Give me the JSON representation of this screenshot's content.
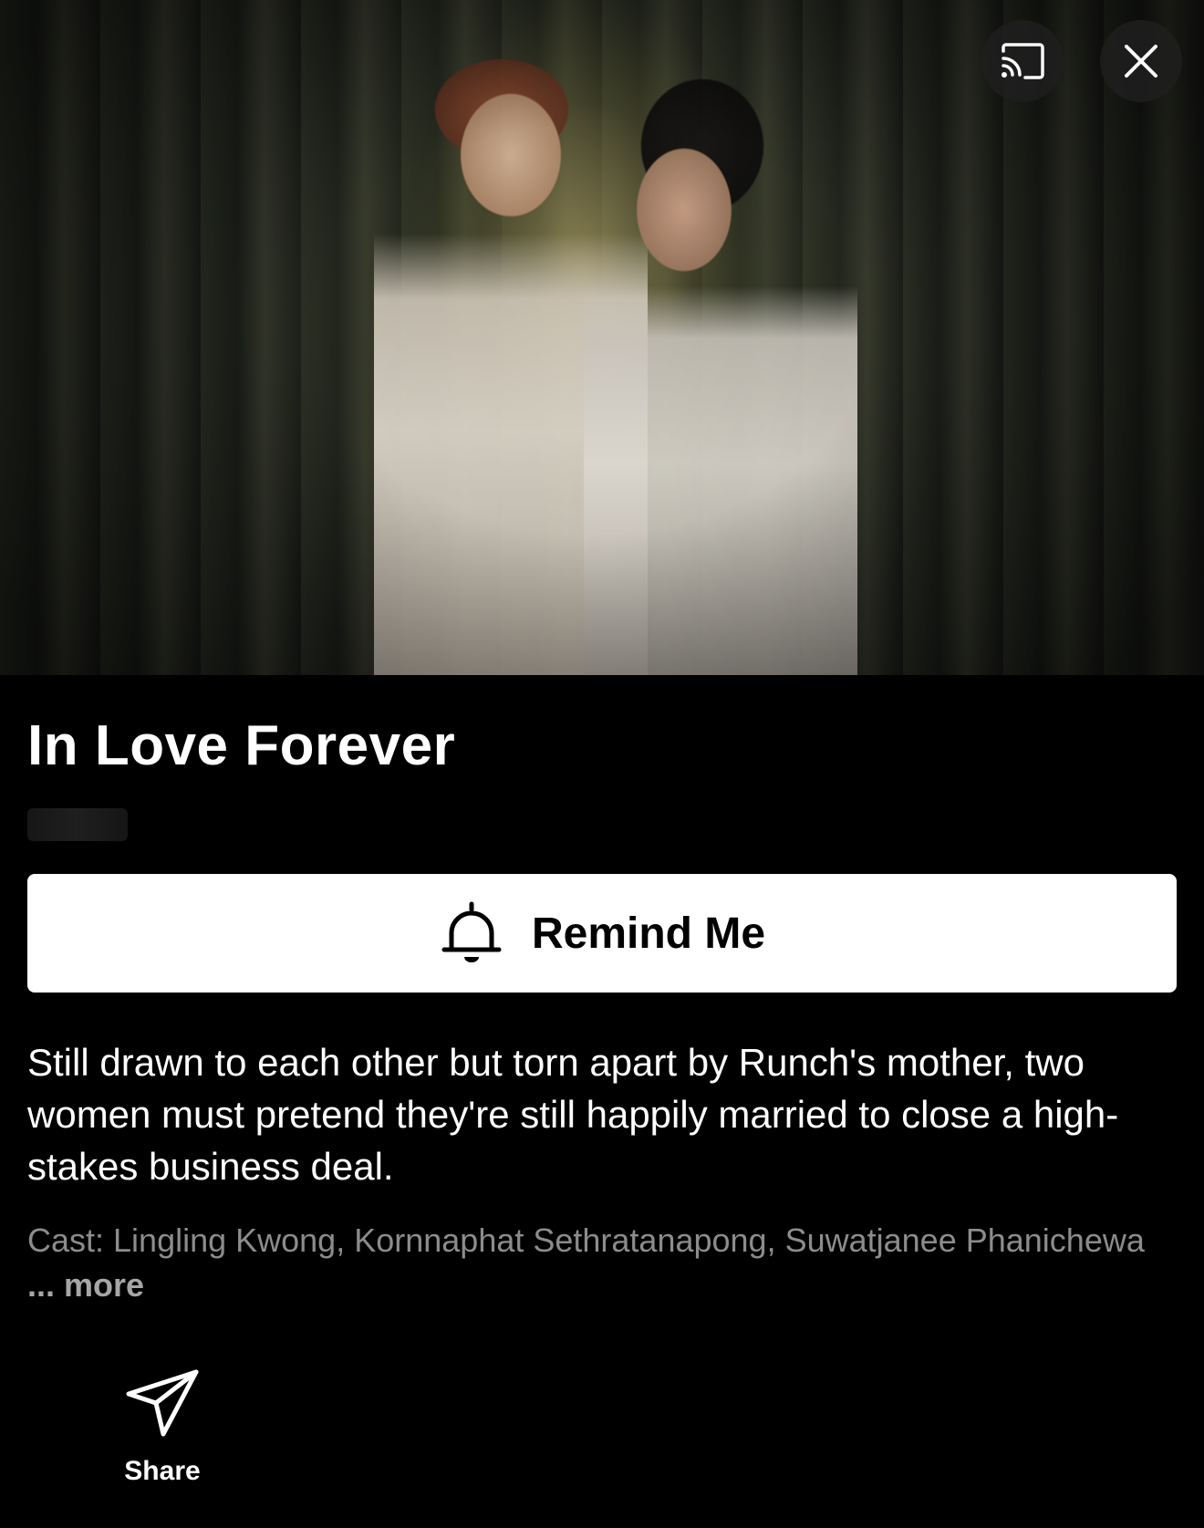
{
  "hero": {
    "cast_icon": "cast-icon",
    "close_icon": "close-icon"
  },
  "title": "In Love Forever",
  "remind": {
    "icon": "bell-icon",
    "label": "Remind Me"
  },
  "synopsis": "Still drawn to each other but torn apart by Runch's mother, two women must pretend they're still happily married to close a high-stakes business deal.",
  "cast": {
    "text": "Cast: Lingling Kwong, Kornnaphat Sethratanapong, Suwatjanee Phanichewa",
    "ellipsis": " ... ",
    "more_label": "more"
  },
  "share": {
    "icon": "share-icon",
    "label": "Share"
  },
  "colors": {
    "background": "#000000",
    "button_bg": "#ffffff",
    "button_text": "#000000",
    "muted_text": "#8c8c8c"
  }
}
